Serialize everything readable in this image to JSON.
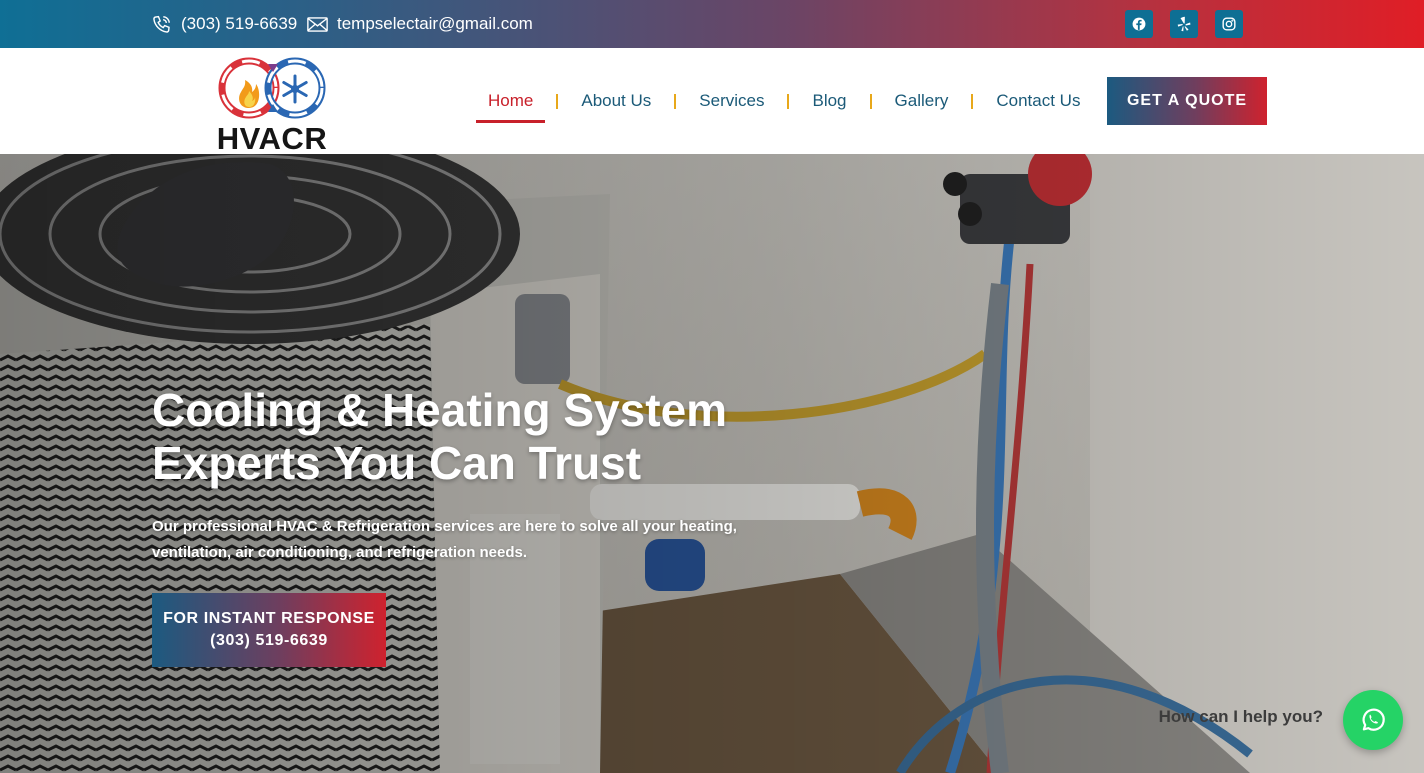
{
  "topbar": {
    "phone": "(303) 519-6639",
    "email": "tempselectair@gmail.com",
    "socials": [
      {
        "icon": "facebook-icon"
      },
      {
        "icon": "yelp-icon"
      },
      {
        "icon": "instagram-icon"
      }
    ],
    "gradient_start": "#0f6f95",
    "gradient_end": "#e01e26"
  },
  "header": {
    "logo_text": "HVACR",
    "nav": [
      {
        "label": "Home",
        "active": true
      },
      {
        "label": "About Us",
        "active": false
      },
      {
        "label": "Services",
        "active": false
      },
      {
        "label": "Blog",
        "active": false
      },
      {
        "label": "Gallery",
        "active": false
      },
      {
        "label": "Contact Us",
        "active": false
      }
    ],
    "quote_button": "GET A QUOTE",
    "active_color": "#c8202a",
    "nav_color": "#1b5a78",
    "separator_color": "#e8a81a"
  },
  "hero": {
    "title_line1": "Cooling & Heating System",
    "title_line2": "Experts You Can Trust",
    "subtitle_line1": "Our professional HVAC & Refrigeration services are here to solve all your heating,",
    "subtitle_line2": "ventilation, air conditioning, and refrigeration needs.",
    "cta_line1": "FOR INSTANT RESPONSE",
    "cta_line2": "(303) 519-6639"
  },
  "chat": {
    "help_text": "How can I help you?",
    "icon": "whatsapp-icon",
    "color": "#25d366"
  }
}
